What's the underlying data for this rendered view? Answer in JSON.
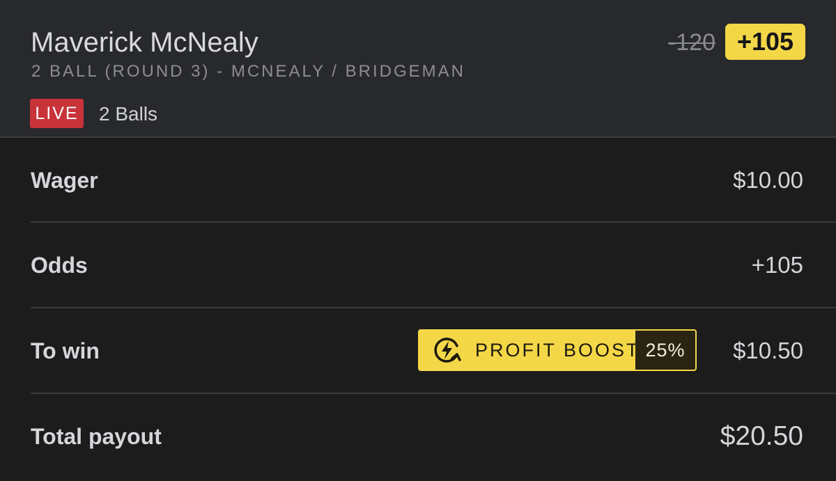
{
  "selection": {
    "name": "Maverick McNealy",
    "market": "2 BALL (ROUND 3) - MCNEALY / BRIDGEMAN",
    "live_label": "LIVE",
    "event_type": "2 Balls",
    "old_odds": "-120",
    "boosted_odds": "+105"
  },
  "rows": {
    "wager": {
      "label": "Wager",
      "value": "$10.00"
    },
    "odds": {
      "label": "Odds",
      "value": "+105"
    },
    "to_win": {
      "label": "To win",
      "value": "$10.50"
    },
    "total_payout": {
      "label": "Total payout",
      "value": "$20.50"
    }
  },
  "profit_boost": {
    "label": "PROFIT BOOST",
    "percent": "25%",
    "icon": "lightning-boost-icon"
  },
  "colors": {
    "accent_yellow": "#f4d747",
    "live_red": "#c8333a",
    "header_bg": "#28292c",
    "body_bg": "#1c1c1d"
  }
}
